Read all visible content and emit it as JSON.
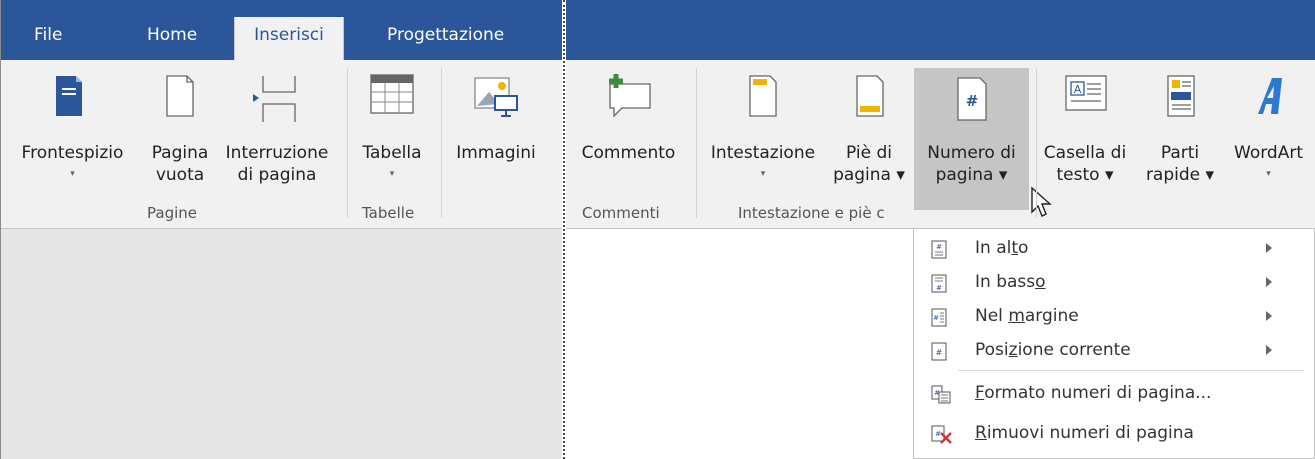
{
  "tabs": {
    "file": "File",
    "home": "Home",
    "insert": "Inserisci",
    "design": "Progettazione"
  },
  "left": {
    "cover": [
      "Frontespizio",
      "▾"
    ],
    "blank": [
      "Pagina",
      "vuota"
    ],
    "pagebreak": [
      "Interruzione",
      "di pagina"
    ],
    "table": [
      "Tabella",
      "▾"
    ],
    "images": [
      "Immagini"
    ],
    "group_pages": "Pagine",
    "group_tables": "Tabelle"
  },
  "right": {
    "comment": [
      "Commento"
    ],
    "header": [
      "Intestazione",
      "▾"
    ],
    "footer": [
      "Piè di",
      "pagina ▾"
    ],
    "pagenumber": [
      "Numero di",
      "pagina ▾"
    ],
    "textbox": [
      "Casella di",
      "testo ▾"
    ],
    "quickparts": [
      "Parti",
      "rapide ▾"
    ],
    "wordart": [
      "WordArt",
      "▾"
    ],
    "group_comments": "Commenti",
    "group_header": "Intestazione e piè c"
  },
  "menu": {
    "top": {
      "pre": "In al",
      "u": "t",
      "post": "o"
    },
    "bottom": {
      "pre": "In bass",
      "u": "o",
      "post": ""
    },
    "margin": {
      "pre": "Nel ",
      "u": "m",
      "post": "argine"
    },
    "current": {
      "pre": "Posi",
      "u": "z",
      "post": "ione corrente"
    },
    "format": {
      "pre": "",
      "u": "F",
      "post": "ormato numeri di pagina..."
    },
    "remove": {
      "pre": "",
      "u": "R",
      "post": "imuovi numeri di pagina"
    }
  },
  "colors": {
    "accent": "#2b579a",
    "ribbon": "#f1f1f1",
    "highlight": "#c5c5c5",
    "remove_x": "#d13438"
  }
}
